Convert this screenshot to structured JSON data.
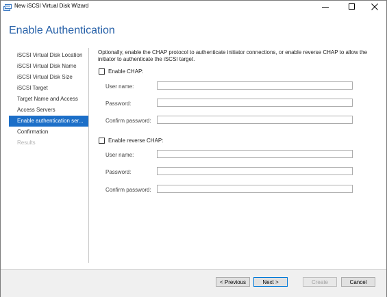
{
  "window": {
    "title": "New iSCSI Virtual Disk Wizard",
    "icon": "wizard-app-icon"
  },
  "page": {
    "title": "Enable Authentication"
  },
  "nav": {
    "items": [
      {
        "label": "iSCSI Virtual Disk Location",
        "state": "normal"
      },
      {
        "label": "iSCSI Virtual Disk Name",
        "state": "normal"
      },
      {
        "label": "iSCSI Virtual Disk Size",
        "state": "normal"
      },
      {
        "label": "iSCSI Target",
        "state": "normal"
      },
      {
        "label": "Target Name and Access",
        "state": "normal"
      },
      {
        "label": "Access Servers",
        "state": "normal"
      },
      {
        "label": "Enable authentication ser...",
        "state": "active"
      },
      {
        "label": "Confirmation",
        "state": "normal"
      },
      {
        "label": "Results",
        "state": "disabled"
      }
    ]
  },
  "content": {
    "description": "Optionally, enable the CHAP protocol to authenticate initiator connections, or enable reverse CHAP to allow the initiator to authenticate the iSCSI target.",
    "chap": {
      "checkbox_label": "Enable CHAP:",
      "checked": false,
      "user_name_label": "User name:",
      "user_name_value": "",
      "password_label": "Password:",
      "password_value": "",
      "confirm_label": "Confirm password:",
      "confirm_value": ""
    },
    "reverse_chap": {
      "checkbox_label": "Enable reverse CHAP:",
      "checked": false,
      "user_name_label": "User name:",
      "user_name_value": "",
      "password_label": "Password:",
      "password_value": "",
      "confirm_label": "Confirm password:",
      "confirm_value": ""
    }
  },
  "footer": {
    "previous_label": "< Previous",
    "next_label": "Next >",
    "create_label": "Create",
    "cancel_label": "Cancel"
  },
  "colors": {
    "title_blue": "#2660a8",
    "nav_active_bg": "#1c6fc8",
    "nav_disabled": "#b5b5b5"
  }
}
